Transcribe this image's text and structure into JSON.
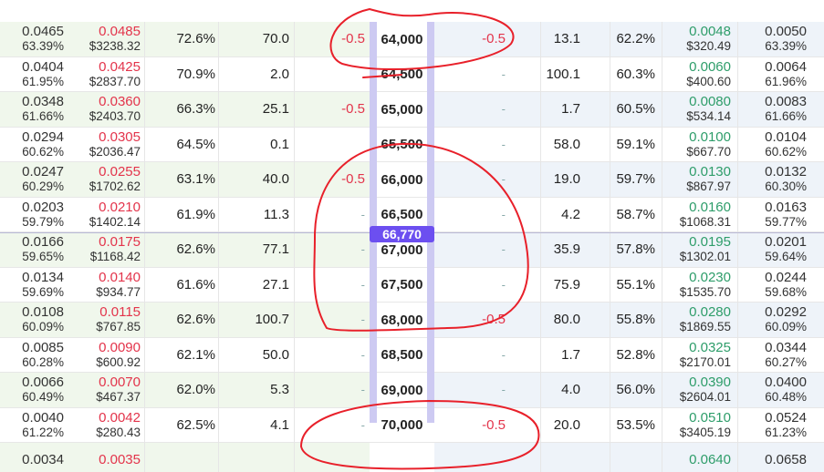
{
  "spot_price": "66,770",
  "rows": [
    {
      "bid": "0.0465",
      "bid_iv": "63.39%",
      "ask": "0.0485",
      "ask_usd": "$3238.32",
      "delta": "72.6%",
      "size": "70.0",
      "pos": "-0.5",
      "strike": "64,000",
      "p_pos": "-0.5",
      "p_size": "13.1",
      "p_delta": "62.2%",
      "p_bid": "0.0048",
      "p_bid_usd": "$320.49",
      "p_ask": "0.0050",
      "p_ask_iv": "63.39%"
    },
    {
      "bid": "0.0404",
      "bid_iv": "61.95%",
      "ask": "0.0425",
      "ask_usd": "$2837.70",
      "delta": "70.9%",
      "size": "2.0",
      "pos": "",
      "strike": "64,500",
      "p_pos": "-",
      "p_size": "100.1",
      "p_delta": "60.3%",
      "p_bid": "0.0060",
      "p_bid_usd": "$400.60",
      "p_ask": "0.0064",
      "p_ask_iv": "61.96%"
    },
    {
      "bid": "0.0348",
      "bid_iv": "61.66%",
      "ask": "0.0360",
      "ask_usd": "$2403.70",
      "delta": "66.3%",
      "size": "25.1",
      "pos": "-0.5",
      "strike": "65,000",
      "p_pos": "-",
      "p_size": "1.7",
      "p_delta": "60.5%",
      "p_bid": "0.0080",
      "p_bid_usd": "$534.14",
      "p_ask": "0.0083",
      "p_ask_iv": "61.66%"
    },
    {
      "bid": "0.0294",
      "bid_iv": "60.62%",
      "ask": "0.0305",
      "ask_usd": "$2036.47",
      "delta": "64.5%",
      "size": "0.1",
      "pos": "",
      "strike": "65,500",
      "p_pos": "-",
      "p_size": "58.0",
      "p_delta": "59.1%",
      "p_bid": "0.0100",
      "p_bid_usd": "$667.70",
      "p_ask": "0.0104",
      "p_ask_iv": "60.62%"
    },
    {
      "bid": "0.0247",
      "bid_iv": "60.29%",
      "ask": "0.0255",
      "ask_usd": "$1702.62",
      "delta": "63.1%",
      "size": "40.0",
      "pos": "-0.5",
      "strike": "66,000",
      "p_pos": "-",
      "p_size": "19.0",
      "p_delta": "59.7%",
      "p_bid": "0.0130",
      "p_bid_usd": "$867.97",
      "p_ask": "0.0132",
      "p_ask_iv": "60.30%"
    },
    {
      "bid": "0.0203",
      "bid_iv": "59.79%",
      "ask": "0.0210",
      "ask_usd": "$1402.14",
      "delta": "61.9%",
      "size": "11.3",
      "pos": "-",
      "strike": "66,500",
      "p_pos": "-",
      "p_size": "4.2",
      "p_delta": "58.7%",
      "p_bid": "0.0160",
      "p_bid_usd": "$1068.31",
      "p_ask": "0.0163",
      "p_ask_iv": "59.77%"
    },
    {
      "bid": "0.0166",
      "bid_iv": "59.65%",
      "ask": "0.0175",
      "ask_usd": "$1168.42",
      "delta": "62.6%",
      "size": "77.1",
      "pos": "-",
      "strike": "67,000",
      "p_pos": "-",
      "p_size": "35.9",
      "p_delta": "57.8%",
      "p_bid": "0.0195",
      "p_bid_usd": "$1302.01",
      "p_ask": "0.0201",
      "p_ask_iv": "59.64%"
    },
    {
      "bid": "0.0134",
      "bid_iv": "59.69%",
      "ask": "0.0140",
      "ask_usd": "$934.77",
      "delta": "61.6%",
      "size": "27.1",
      "pos": "-",
      "strike": "67,500",
      "p_pos": "-",
      "p_size": "75.9",
      "p_delta": "55.1%",
      "p_bid": "0.0230",
      "p_bid_usd": "$1535.70",
      "p_ask": "0.0244",
      "p_ask_iv": "59.68%"
    },
    {
      "bid": "0.0108",
      "bid_iv": "60.09%",
      "ask": "0.0115",
      "ask_usd": "$767.85",
      "delta": "62.6%",
      "size": "100.7",
      "pos": "-",
      "strike": "68,000",
      "p_pos": "-0.5",
      "p_size": "80.0",
      "p_delta": "55.8%",
      "p_bid": "0.0280",
      "p_bid_usd": "$1869.55",
      "p_ask": "0.0292",
      "p_ask_iv": "60.09%"
    },
    {
      "bid": "0.0085",
      "bid_iv": "60.28%",
      "ask": "0.0090",
      "ask_usd": "$600.92",
      "delta": "62.1%",
      "size": "50.0",
      "pos": "-",
      "strike": "68,500",
      "p_pos": "-",
      "p_size": "1.7",
      "p_delta": "52.8%",
      "p_bid": "0.0325",
      "p_bid_usd": "$2170.01",
      "p_ask": "0.0344",
      "p_ask_iv": "60.27%"
    },
    {
      "bid": "0.0066",
      "bid_iv": "60.49%",
      "ask": "0.0070",
      "ask_usd": "$467.37",
      "delta": "62.0%",
      "size": "5.3",
      "pos": "-",
      "strike": "69,000",
      "p_pos": "-",
      "p_size": "4.0",
      "p_delta": "56.0%",
      "p_bid": "0.0390",
      "p_bid_usd": "$2604.01",
      "p_ask": "0.0400",
      "p_ask_iv": "60.48%"
    },
    {
      "bid": "0.0040",
      "bid_iv": "61.22%",
      "ask": "0.0042",
      "ask_usd": "$280.43",
      "delta": "62.5%",
      "size": "4.1",
      "pos": "-",
      "strike": "70,000",
      "p_pos": "-0.5",
      "p_size": "20.0",
      "p_delta": "53.5%",
      "p_bid": "0.0510",
      "p_bid_usd": "$3405.19",
      "p_ask": "0.0524",
      "p_ask_iv": "61.23%"
    },
    {
      "bid": "0.0034",
      "bid_iv": "",
      "ask": "0.0035",
      "ask_usd": "",
      "delta": "",
      "size": "",
      "pos": "",
      "strike": "",
      "p_pos": "",
      "p_size": "",
      "p_delta": "",
      "p_bid": "0.0640",
      "p_bid_usd": "",
      "p_ask": "0.0658",
      "p_ask_iv": ""
    }
  ],
  "colors": {
    "call_bg": "#f0f7ec",
    "put_bg": "#eef3f9",
    "ask_red": "#e3344b",
    "bid_green": "#2e9d6a",
    "strike_bar": "#cdcaf2",
    "spot_badge": "#6c4ff0",
    "annotation": "#e8202a"
  }
}
